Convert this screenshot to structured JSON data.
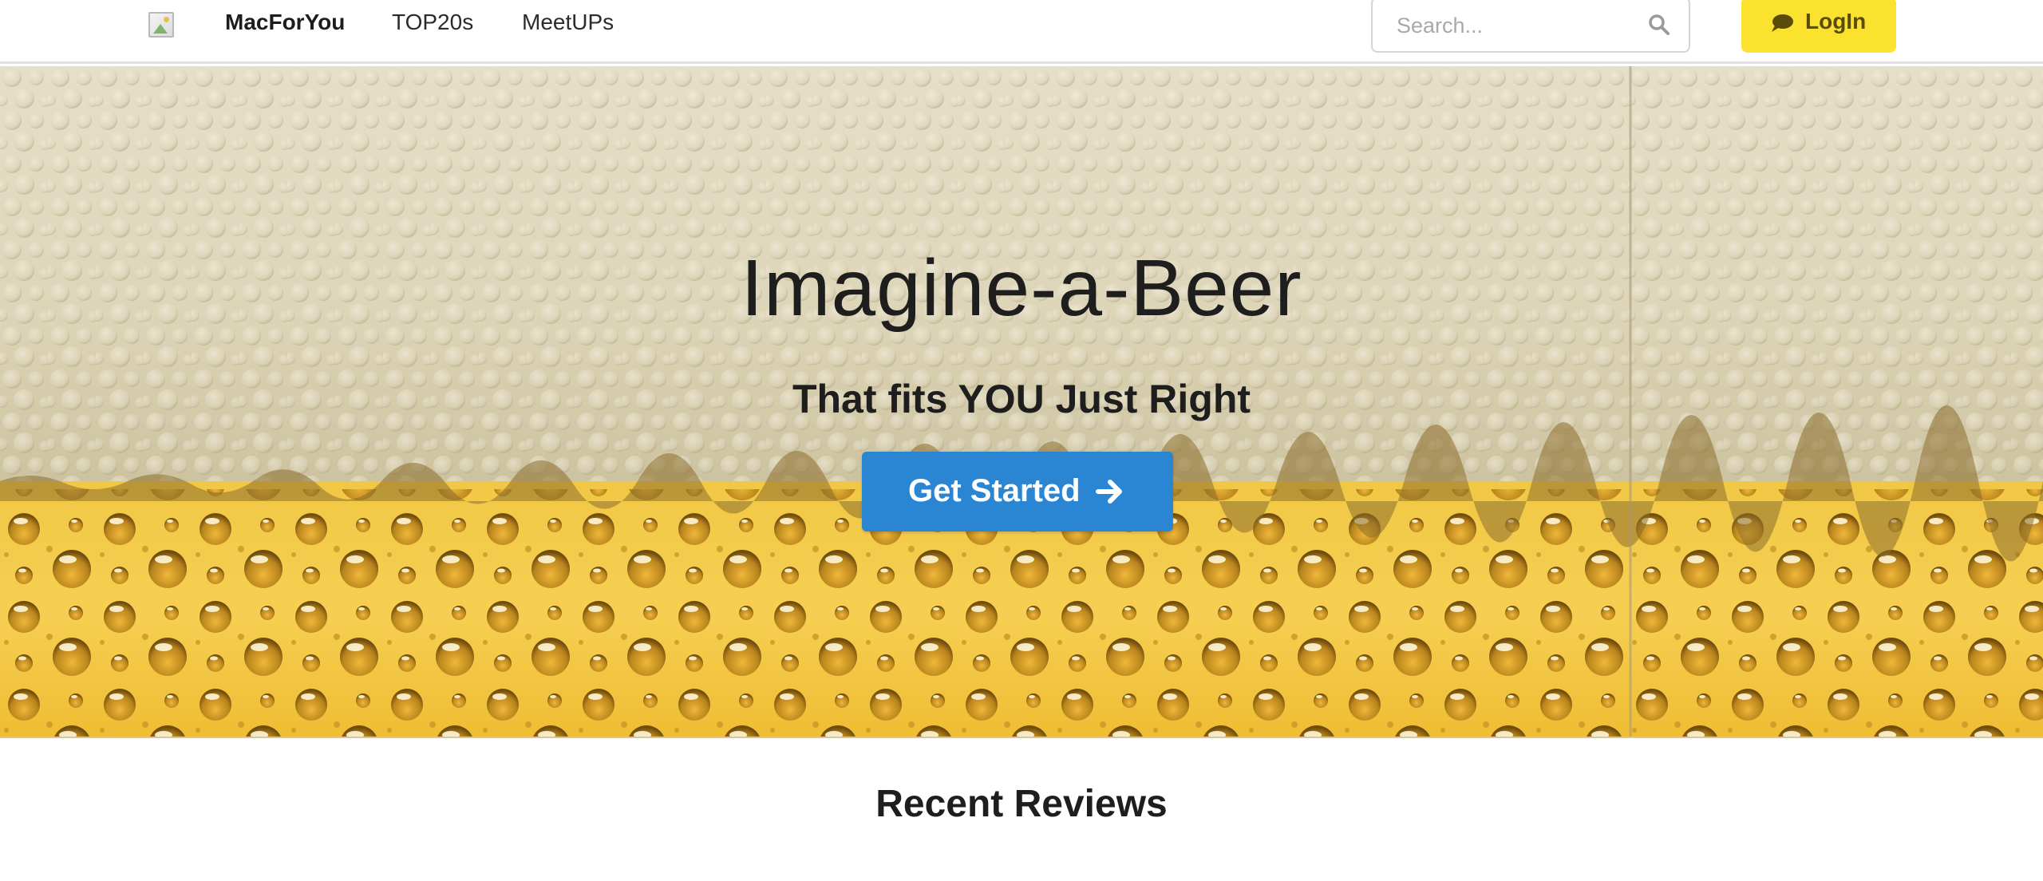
{
  "navbar": {
    "brand": "MacForYou",
    "links": [
      "TOP20s",
      "MeetUPs"
    ],
    "search": {
      "placeholder": "Search...",
      "icon": "search-icon"
    },
    "login": {
      "label": "LogIn",
      "icon": "chat-bubble-icon",
      "color": "#fbe22f"
    }
  },
  "hero": {
    "title": "Imagine-a-Beer",
    "subtitle": "That fits YOU Just Right",
    "cta": {
      "label": "Get Started",
      "icon": "arrow-right-icon",
      "color": "#2a86d3"
    }
  },
  "sections": {
    "recent_reviews_title": "Recent Reviews"
  }
}
